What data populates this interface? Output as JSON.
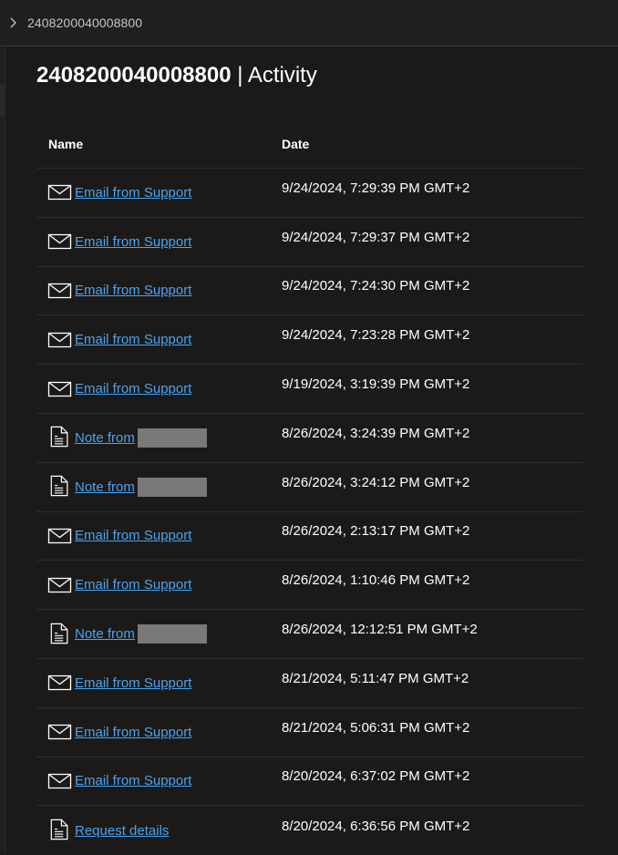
{
  "breadcrumb": {
    "chevron_icon": "chevron-right-icon",
    "text": "2408200040008800"
  },
  "title": {
    "case_id": "2408200040008800",
    "separator": "|",
    "section": "Activity"
  },
  "table": {
    "headers": {
      "name": "Name",
      "date": "Date"
    },
    "rows": [
      {
        "type": "email",
        "icon": "envelope-icon",
        "label": "Email from Support",
        "redacted": false,
        "date": "9/24/2024, 7:29:39 PM GMT+2"
      },
      {
        "type": "email",
        "icon": "envelope-icon",
        "label": "Email from Support",
        "redacted": false,
        "date": "9/24/2024, 7:29:37 PM GMT+2"
      },
      {
        "type": "email",
        "icon": "envelope-icon",
        "label": "Email from Support",
        "redacted": false,
        "date": "9/24/2024, 7:24:30 PM GMT+2"
      },
      {
        "type": "email",
        "icon": "envelope-icon",
        "label": "Email from Support",
        "redacted": false,
        "date": "9/24/2024, 7:23:28 PM GMT+2"
      },
      {
        "type": "email",
        "icon": "envelope-icon",
        "label": "Email from Support",
        "redacted": false,
        "date": "9/19/2024, 3:19:39 PM GMT+2"
      },
      {
        "type": "note",
        "icon": "document-icon",
        "label": "Note from",
        "redacted": true,
        "date": "8/26/2024, 3:24:39 PM GMT+2"
      },
      {
        "type": "note",
        "icon": "document-icon",
        "label": "Note from",
        "redacted": true,
        "date": "8/26/2024, 3:24:12 PM GMT+2"
      },
      {
        "type": "email",
        "icon": "envelope-icon",
        "label": "Email from Support",
        "redacted": false,
        "date": "8/26/2024, 2:13:17 PM GMT+2"
      },
      {
        "type": "email",
        "icon": "envelope-icon",
        "label": "Email from Support",
        "redacted": false,
        "date": "8/26/2024, 1:10:46 PM GMT+2"
      },
      {
        "type": "note",
        "icon": "document-icon",
        "label": "Note from",
        "redacted": true,
        "date": "8/26/2024, 12:12:51 PM GMT+2"
      },
      {
        "type": "email",
        "icon": "envelope-icon",
        "label": "Email from Support",
        "redacted": false,
        "date": "8/21/2024, 5:11:47 PM GMT+2"
      },
      {
        "type": "email",
        "icon": "envelope-icon",
        "label": "Email from Support",
        "redacted": false,
        "date": "8/21/2024, 5:06:31 PM GMT+2"
      },
      {
        "type": "email",
        "icon": "envelope-icon",
        "label": "Email from Support",
        "redacted": false,
        "date": "8/20/2024, 6:37:02 PM GMT+2"
      },
      {
        "type": "note",
        "icon": "document-icon",
        "label": "Request details",
        "redacted": false,
        "date": "8/20/2024, 6:36:56 PM GMT+2"
      }
    ]
  },
  "colors": {
    "background": "#1b1a19",
    "link": "#4aa3f0",
    "redaction": "#7a7978",
    "divider": "#2f2e2d"
  }
}
